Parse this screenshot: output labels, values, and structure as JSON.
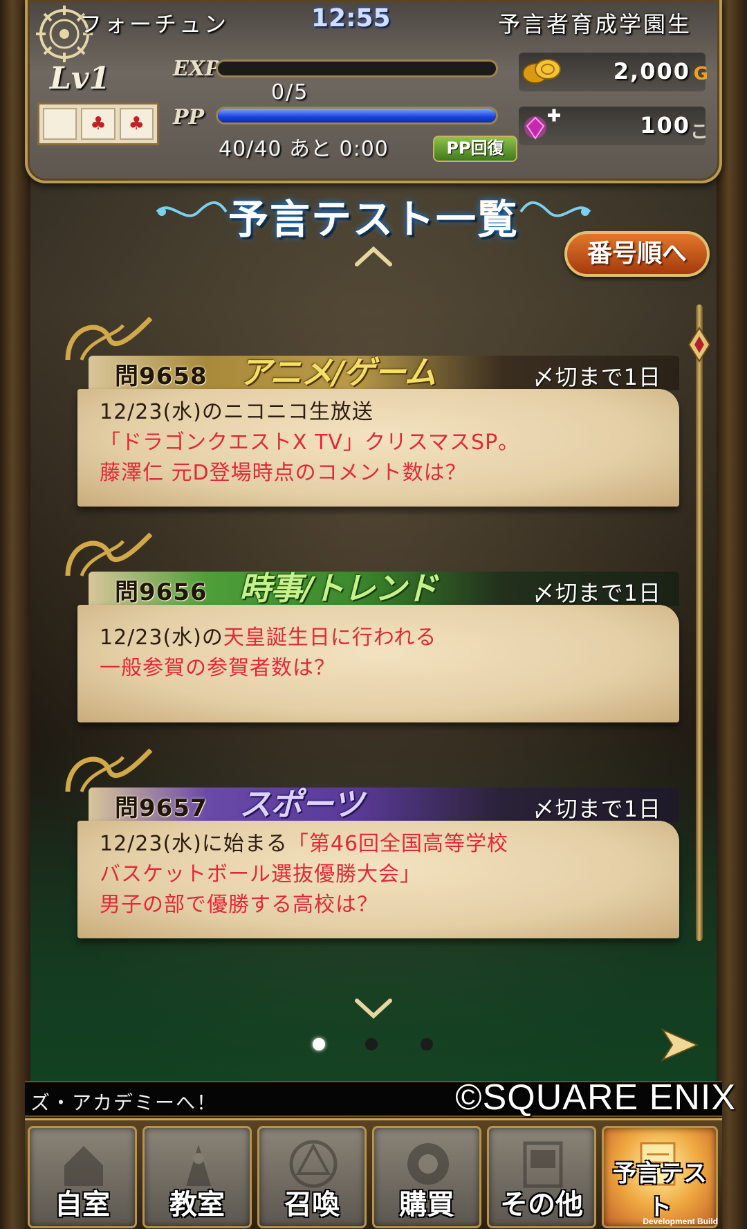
{
  "header": {
    "title_left": "フォーチュン",
    "clock": "12:55",
    "title_right": "予言者育成学園生",
    "level": "Lv1",
    "exp_label": "EXP",
    "exp_value": "0/5",
    "exp_progress": 0.0,
    "pp_label": "PP",
    "pp_value": "40/40 あと 0:00",
    "pp_progress": 1.0,
    "pp_recover_label": "PP回復",
    "gold_value": "2,000",
    "gold_unit": "G",
    "gem_value": "100",
    "gem_unit": "こ",
    "cards": [
      "",
      "♣",
      "♣"
    ]
  },
  "section": {
    "title": "予言テスト一覧",
    "sort_label": "番号順へ"
  },
  "questions": [
    {
      "number": "問9658",
      "category": "アニメ/ゲーム",
      "deadline": "〆切まで1日",
      "line1_plain": "12/23(水)のニコニコ生放送",
      "line2_highlight": "「ドラゴンクエストX TV」クリスマスSP。",
      "line3_highlight": "藤澤仁 元D登場時点のコメント数は？"
    },
    {
      "number": "問9656",
      "category": "時事/トレンド",
      "deadline": "〆切まで1日",
      "line1_plain": "12/23(水)の",
      "line1_highlight": "天皇誕生日に行われる",
      "line2_highlight": "一般参賀の参賀者数は？"
    },
    {
      "number": "問9657",
      "category": "スポーツ",
      "deadline": "〆切まで1日",
      "line1_plain": "12/23(水)に始まる",
      "line1_highlight": "「第46回全国高等学校",
      "line2_highlight": "バスケットボール選抜優勝大会」",
      "line3_plain": "男子の部で優勝する高校は？"
    }
  ],
  "pagination": {
    "current": 1,
    "total": 3
  },
  "ticker": {
    "text": "ズ・アカデミーへ！"
  },
  "copyright": "©SQUARE ENIX",
  "nav": [
    {
      "label": "自室",
      "icon": "home-icon"
    },
    {
      "label": "教室",
      "icon": "classroom-icon"
    },
    {
      "label": "召喚",
      "icon": "summon-circle-icon"
    },
    {
      "label": "購買",
      "icon": "shop-icon"
    },
    {
      "label": "その他",
      "icon": "other-icon"
    },
    {
      "label": "予言テスト",
      "icon": "prophecy-test-icon"
    }
  ],
  "dev_build": "Development Build",
  "colors": {
    "accent_gold": "#b89b54",
    "highlight_red": "#e0293a",
    "pp_blue": "#1742e0",
    "sort_orange": "#e2772a"
  }
}
